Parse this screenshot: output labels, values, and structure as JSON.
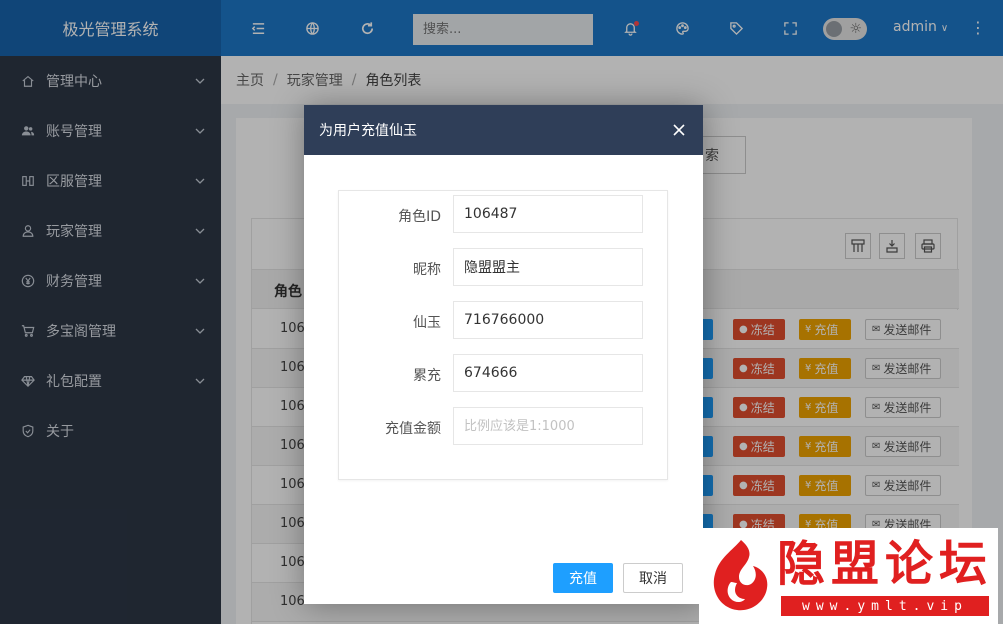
{
  "app": {
    "title": "极光管理系统"
  },
  "header": {
    "search_placeholder": "搜索...",
    "user": "admin",
    "icons": [
      "menu-fold-icon",
      "globe-icon",
      "refresh-icon",
      "bell-icon",
      "theme-icon",
      "tag-icon",
      "fullscreen-icon",
      "theme-toggle",
      "more-icon"
    ]
  },
  "sidebar": {
    "items": [
      {
        "label": "管理中心",
        "icon": "home-icon",
        "expandable": true
      },
      {
        "label": "账号管理",
        "icon": "users-icon",
        "expandable": true
      },
      {
        "label": "区服管理",
        "icon": "server-icon",
        "expandable": true
      },
      {
        "label": "玩家管理",
        "icon": "user-icon",
        "expandable": true
      },
      {
        "label": "财务管理",
        "icon": "yen-icon",
        "expandable": true
      },
      {
        "label": "多宝阁管理",
        "icon": "cart-icon",
        "expandable": true
      },
      {
        "label": "礼包配置",
        "icon": "diamond-icon",
        "expandable": true
      },
      {
        "label": "关于",
        "icon": "shield-check-icon",
        "expandable": false
      }
    ]
  },
  "breadcrumb": [
    "主页",
    "玩家管理",
    "角色列表"
  ],
  "table": {
    "header_first": "角色",
    "search_button": "索",
    "rows": [
      {
        "id": "106"
      },
      {
        "id": "106"
      },
      {
        "id": "106"
      },
      {
        "id": "106"
      },
      {
        "id": "106"
      },
      {
        "id": "106"
      },
      {
        "id": "106"
      },
      {
        "id": "106"
      }
    ],
    "actions": {
      "freeze": "冻结",
      "recharge": "充值",
      "mail": "发送邮件"
    }
  },
  "modal": {
    "title": "为用户充值仙玉",
    "fields": [
      {
        "label": "角色ID",
        "value": "106487",
        "placeholder": ""
      },
      {
        "label": "昵称",
        "value": "隐盟盟主",
        "placeholder": ""
      },
      {
        "label": "仙玉",
        "value": "716766000",
        "placeholder": ""
      },
      {
        "label": "累充",
        "value": "674666",
        "placeholder": ""
      },
      {
        "label": "充值金额",
        "value": "",
        "placeholder": "比例应该是1:1000"
      }
    ],
    "ok_label": "充值",
    "cancel_label": "取消"
  },
  "watermark": {
    "title": "隐盟论坛",
    "url": "www.ymlt.vip"
  },
  "colors": {
    "brand_blue": "#1e78c8",
    "sidebar": "#2d3746",
    "modal_head": "#2f3e58",
    "primary": "#1e9fff",
    "danger": "#e14e2e",
    "warn": "#f0a400"
  }
}
